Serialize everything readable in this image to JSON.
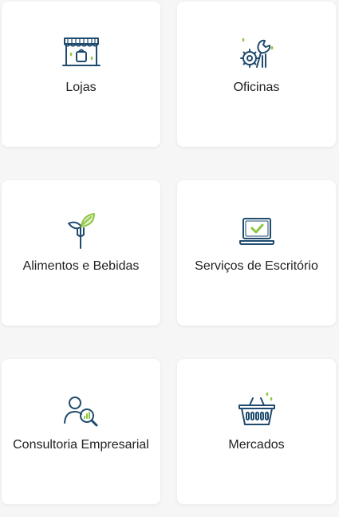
{
  "colors": {
    "icon_primary": "#1f4b6e",
    "icon_accent": "#8cc63f",
    "card_background": "#ffffff",
    "page_background": "#f6f6f6",
    "label_text": "#222222"
  },
  "categories": [
    {
      "label": "Lojas",
      "icon": "storefront-icon"
    },
    {
      "label": "Oficinas",
      "icon": "wrench-gear-icon"
    },
    {
      "label": "Alimentos e Bebidas",
      "icon": "leaf-fork-icon"
    },
    {
      "label": "Serviços de Escritório",
      "icon": "laptop-check-icon"
    },
    {
      "label": "Consultoria Empresarial",
      "icon": "person-magnifier-icon"
    },
    {
      "label": "Mercados",
      "icon": "basket-icon"
    }
  ]
}
